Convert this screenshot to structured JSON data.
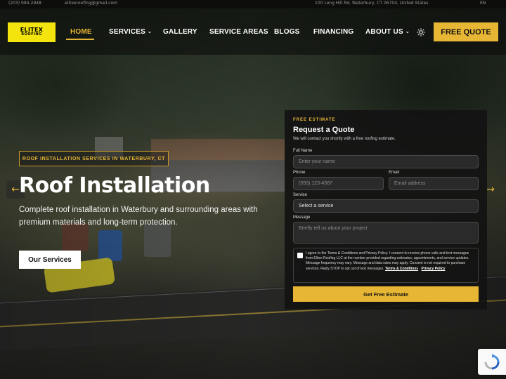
{
  "topbar": {
    "phone": "(203) 994-2948",
    "email": "elitexroofing@gmail.com",
    "address": "100 Long Hill Rd, Waterbury, CT 06704, United States",
    "language": "EN"
  },
  "nav": {
    "logo_line1": "ELITEX",
    "logo_line2": "ROOFING",
    "items": [
      {
        "label": "HOME"
      },
      {
        "label": "SERVICES"
      },
      {
        "label": "GALLERY"
      },
      {
        "label": "SERVICE AREAS"
      },
      {
        "label": "BLOGS"
      },
      {
        "label": "FINANCING"
      },
      {
        "label": "ABOUT US"
      }
    ],
    "cta": "FREE QUOTE"
  },
  "hero": {
    "badge": "ROOF INSTALLATION SERVICES IN WATERBURY, CT",
    "title": "Roof Installation",
    "subtitle": "Complete roof installation in Waterbury and surrounding areas with premium materials and long-term protection.",
    "button": "Our Services"
  },
  "form": {
    "kicker": "FREE ESTIMATE",
    "title": "Request a Quote",
    "description": "We will contact you shortly with a free roofing estimate.",
    "name_label": "Full Name",
    "name_placeholder": "Enter your name",
    "phone_label": "Phone",
    "phone_placeholder": "(555) 123-4567",
    "email_label": "Email",
    "email_placeholder": "Email address",
    "service_label": "Service",
    "service_value": "Select a service",
    "message_label": "Message",
    "message_placeholder": "Briefly tell us about your project",
    "consent": "I agree to the Terms & Conditions and Privacy Policy. I consent to receive phone calls and text messages from Elitex Roofing LLC at the number provided regarding estimates, appointments, and service updates. Message frequency may vary. Message and data rates may apply. Consent is not required to purchase services. Reply STOP to opt out of text messages.",
    "terms_link": "Terms & Conditions",
    "privacy_link": "Privacy Policy",
    "submit": "Get Free Estimate"
  },
  "colors": {
    "accent": "#e7b634",
    "logo_bg": "#f2e40c",
    "panel_bg": "#121212"
  }
}
